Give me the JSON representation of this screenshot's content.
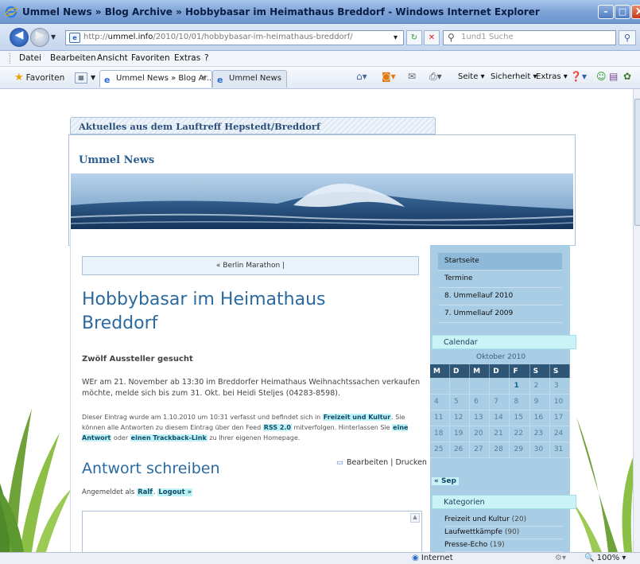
{
  "window": {
    "title": "Ummel News » Blog Archive » Hobbybasar im Heimathaus Breddorf - Windows Internet Explorer",
    "min_label": "–",
    "max_label": "□",
    "close_label": "X"
  },
  "address": {
    "url_prefix": "http://",
    "url_host": "ummel.info",
    "url_path": "/2010/10/01/hobbybasar-im-heimathaus-breddorf/",
    "search_placeholder": "1und1 Suche"
  },
  "menu": [
    "Datei",
    "Bearbeiten",
    "Ansicht",
    "Favoriten",
    "Extras",
    "?"
  ],
  "favorites": {
    "label": "Favoriten",
    "tabs": [
      "Ummel News » Blog Ar...",
      "Ummel News"
    ],
    "commands": [
      "Seite ▾",
      "Sicherheit ▾",
      "Extras ▾"
    ]
  },
  "page": {
    "tagline": "Aktuelles aus dem Lauftreff Hepstedt/Breddorf",
    "blog_name": "Ummel News",
    "post_nav": "« Berlin Marathon  |",
    "post_title": "Hobbybasar im Heimathaus Breddorf",
    "excerpt": "Zwölf Aussteller gesucht",
    "body": "WEr am 21. November ab 13:30 im Breddorfer Heimathaus Weihnachtssachen verkaufen möchte, melde sich bis zum 31. Okt. bei Heidi Steljes (04283-8598).",
    "meta": {
      "t1": "Dieser Eintrag wurde am 1.10.2010 um 10:31 verfasst und befindet sich in ",
      "cat_link": "Freizeit und Kultur",
      "t2": ". Sie können alle Antworten zu diesem Eintrag über den Feed ",
      "rss_link": "RSS 2.0",
      "t3": " mitverfolgen. Hinterlassen Sie ",
      "reply_link": "eine Antwort",
      "t4": " oder ",
      "trackback_link": "einen Trackback-Link",
      "t5": " zu Ihrer eigenen Homepage."
    },
    "reply_title": "Antwort schreiben",
    "edit_label": "Bearbeiten",
    "edit_sep": "|",
    "print_label": "Drucken",
    "logged_in_prefix": "Angemeldet als ",
    "user": "Ralf",
    "logged_in_sep": ". ",
    "logout": "Logout »"
  },
  "sidebar": {
    "nav": [
      "Startseite",
      "Termine",
      "8. Ummellauf 2010",
      "7. Ummellauf 2009"
    ],
    "calendar_title": "Calendar",
    "calendar_month": "Oktober 2010",
    "weekdays": [
      "M",
      "D",
      "M",
      "D",
      "F",
      "S",
      "S"
    ],
    "weeks": [
      [
        "",
        "",
        "",
        "",
        "1",
        "2",
        "3"
      ],
      [
        "4",
        "5",
        "6",
        "7",
        "8",
        "9",
        "10"
      ],
      [
        "11",
        "12",
        "13",
        "14",
        "15",
        "16",
        "17"
      ],
      [
        "18",
        "19",
        "20",
        "21",
        "22",
        "23",
        "24"
      ],
      [
        "25",
        "26",
        "27",
        "28",
        "29",
        "30",
        "31"
      ]
    ],
    "calendar_prev": "« Sep",
    "categories_title": "Kategorien",
    "categories": [
      {
        "name": "Freizeit und Kultur",
        "count": "(20)"
      },
      {
        "name": "Laufwettkämpfe",
        "count": "(90)"
      },
      {
        "name": "Presse-Echo",
        "count": "(19)"
      }
    ]
  },
  "status": {
    "zone": "Internet",
    "zoom": "100%"
  }
}
